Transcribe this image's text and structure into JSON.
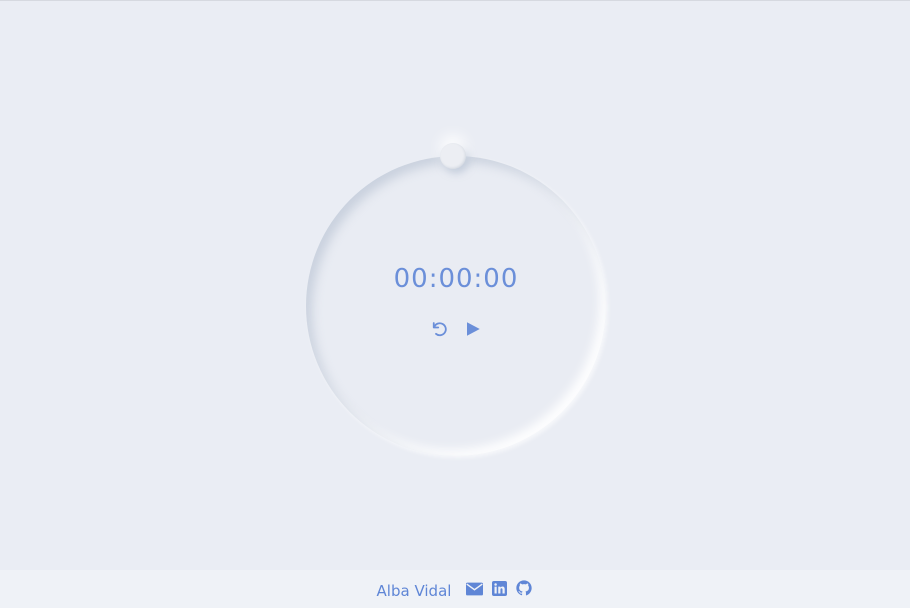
{
  "timer": {
    "time": "00:00:00",
    "reset_icon": "reset-icon",
    "play_icon": "play-icon"
  },
  "footer": {
    "author": "Alba Vidal",
    "links": [
      {
        "icon": "mail-icon"
      },
      {
        "icon": "linkedin-icon"
      },
      {
        "icon": "github-icon"
      }
    ]
  },
  "colors": {
    "background": "#eaedf4",
    "accent": "#6b8fd9",
    "footer_bg": "#eff2f7"
  }
}
